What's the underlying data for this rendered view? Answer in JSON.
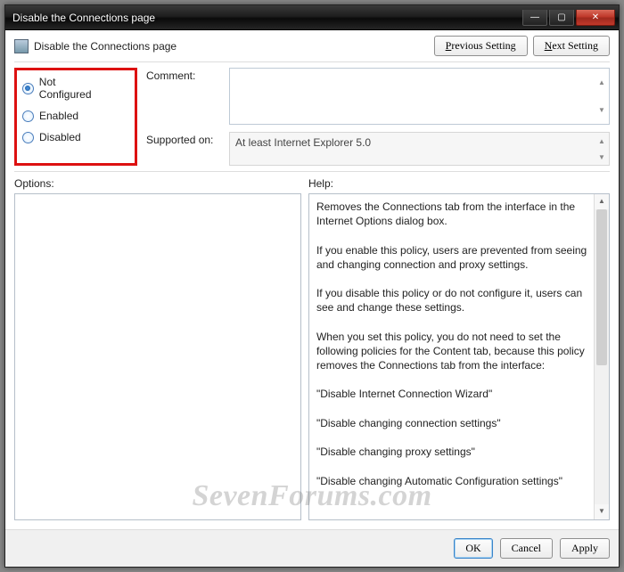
{
  "window": {
    "title": "Disable the Connections page"
  },
  "header": {
    "page_title": "Disable the Connections page",
    "prev_p": "P",
    "prev_rest": "revious Setting",
    "next_n": "N",
    "next_rest": "ext Setting"
  },
  "state": {
    "options": [
      "Not Configured",
      "Enabled",
      "Disabled"
    ],
    "selected_index": 0
  },
  "fields": {
    "comment_label": "Comment:",
    "comment_value": "",
    "supported_label": "Supported on:",
    "supported_value": "At least Internet Explorer 5.0"
  },
  "lower": {
    "options_label": "Options:",
    "options_body": "",
    "help_label": "Help:",
    "help_body": "Removes the Connections tab from the interface in the Internet Options dialog box.\n\nIf you enable this policy, users are prevented from seeing and changing connection and proxy settings.\n\nIf you disable this policy or do not configure it, users can see and change these settings.\n\nWhen you set this policy, you do not need to set the following policies for the Content tab, because this policy removes the Connections tab from the interface:\n\n\"Disable Internet Connection Wizard\"\n\n\"Disable changing connection settings\"\n\n\"Disable changing proxy settings\"\n\n\"Disable changing Automatic Configuration settings\""
  },
  "footer": {
    "ok": "OK",
    "cancel": "Cancel",
    "apply": "Apply"
  },
  "watermark": "SevenForums.com"
}
